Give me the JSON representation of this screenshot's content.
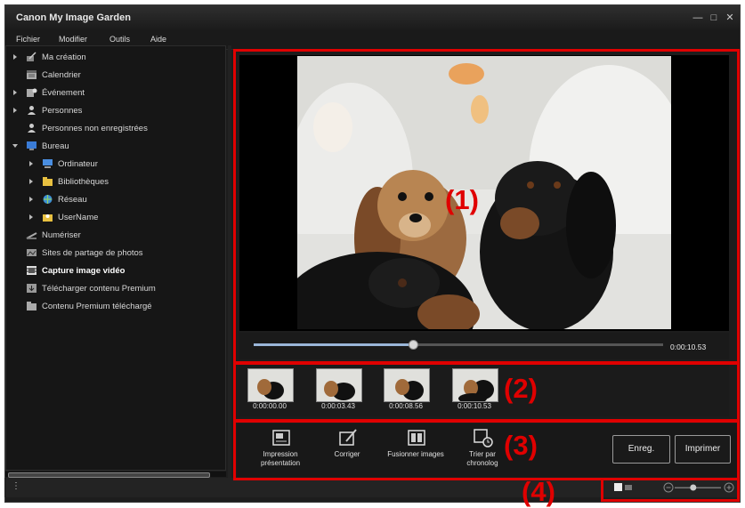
{
  "window": {
    "title": "Canon My Image Garden"
  },
  "menu": [
    "Fichier",
    "Modifier",
    "Outils",
    "Aide"
  ],
  "sidebar": {
    "items": [
      {
        "label": "Ma création",
        "icon": "my-art-icon",
        "arrow": "collapsed"
      },
      {
        "label": "Calendrier",
        "icon": "calendar-icon",
        "arrow": "none"
      },
      {
        "label": "Événement",
        "icon": "event-icon",
        "arrow": "collapsed"
      },
      {
        "label": "Personnes",
        "icon": "people-icon",
        "arrow": "collapsed"
      },
      {
        "label": "Personnes non enregistrées",
        "icon": "person-icon",
        "arrow": "none"
      },
      {
        "label": "Bureau",
        "icon": "desktop-icon",
        "arrow": "expanded"
      },
      {
        "label": "Ordinateur",
        "icon": "computer-icon",
        "arrow": "collapsed"
      },
      {
        "label": "Bibliothèques",
        "icon": "library-icon",
        "arrow": "collapsed"
      },
      {
        "label": "Réseau",
        "icon": "network-icon",
        "arrow": "collapsed"
      },
      {
        "label": "UserName",
        "icon": "user-folder-icon",
        "arrow": "collapsed"
      },
      {
        "label": "Numériser",
        "icon": "scan-icon",
        "arrow": "none"
      },
      {
        "label": "Sites de partage de photos",
        "icon": "photo-sharing-icon",
        "arrow": "none"
      },
      {
        "label": "Capture image vidéo",
        "icon": "video-frame-icon",
        "arrow": "none",
        "selected": true
      },
      {
        "label": "Télécharger contenu Premium",
        "icon": "download-premium-icon",
        "arrow": "none"
      },
      {
        "label": "Contenu Premium téléchargé",
        "icon": "premium-folder-icon",
        "arrow": "none"
      }
    ]
  },
  "playback": {
    "time": "0:00:10.53",
    "progress": 0.39
  },
  "thumbnails": [
    "0:00:00.00",
    "0:00:03.43",
    "0:00:08.56",
    "0:00:10.53"
  ],
  "toolbar": {
    "tools": [
      {
        "label": "Impression présentation",
        "icon": "print-layout-icon"
      },
      {
        "label": "Corriger",
        "icon": "correct-icon"
      },
      {
        "label": "Fusionner images",
        "icon": "merge-icon"
      },
      {
        "label": "Trier par chronolog",
        "icon": "sort-chrono-icon"
      }
    ],
    "save_label": "Enreg.",
    "print_label": "Imprimer"
  },
  "zoom": {
    "level": 0.4
  },
  "annotations": [
    "(1)",
    "(2)",
    "(3)",
    "(4)"
  ],
  "colors": {
    "annotation": "#e00000",
    "background": "#1d1d1d"
  }
}
